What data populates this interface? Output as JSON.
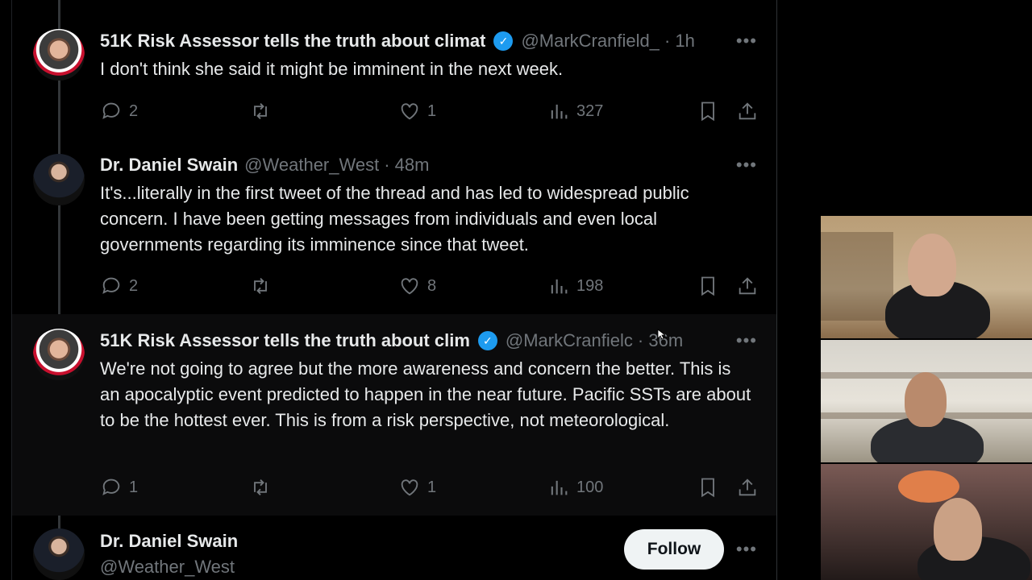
{
  "tweets": [
    {
      "name": "51K Risk Assessor tells the truth about climat",
      "handle": "@MarkCranfield_",
      "time": "· 1h",
      "text": "I don't think she said it might be imminent in the next week.",
      "replies": "2",
      "retweets": "",
      "likes": "1",
      "views": "327"
    },
    {
      "name": "Dr. Daniel Swain",
      "handle": "@Weather_West",
      "time": "· 48m",
      "text": "It's...literally in the first tweet of the thread and has led to widespread public concern. I have been getting messages from individuals and even local governments regarding its imminence since that tweet.",
      "replies": "2",
      "retweets": "",
      "likes": "8",
      "views": "198"
    },
    {
      "name": "51K Risk Assessor tells the truth about clim",
      "handle": "@MarkCranfielc",
      "time": "· 36m",
      "text": "We're not going to agree but the more awareness and concern the better. This is an apocalyptic event predicted to happen in the near future. Pacific SSTs are about to be the hottest ever. This is from a risk perspective, not meteorological.",
      "replies": "1",
      "retweets": "",
      "likes": "1",
      "views": "100"
    }
  ],
  "profile_card": {
    "name": "Dr. Daniel Swain",
    "handle": "@Weather_West",
    "follow_label": "Follow"
  },
  "more_label": "•••",
  "verified_glyph": "✓",
  "colors": {
    "background": "#000000",
    "text": "#e7e9ea",
    "muted": "#71767b",
    "verified": "#1d9bf0",
    "follow_bg": "#eff3f4"
  }
}
